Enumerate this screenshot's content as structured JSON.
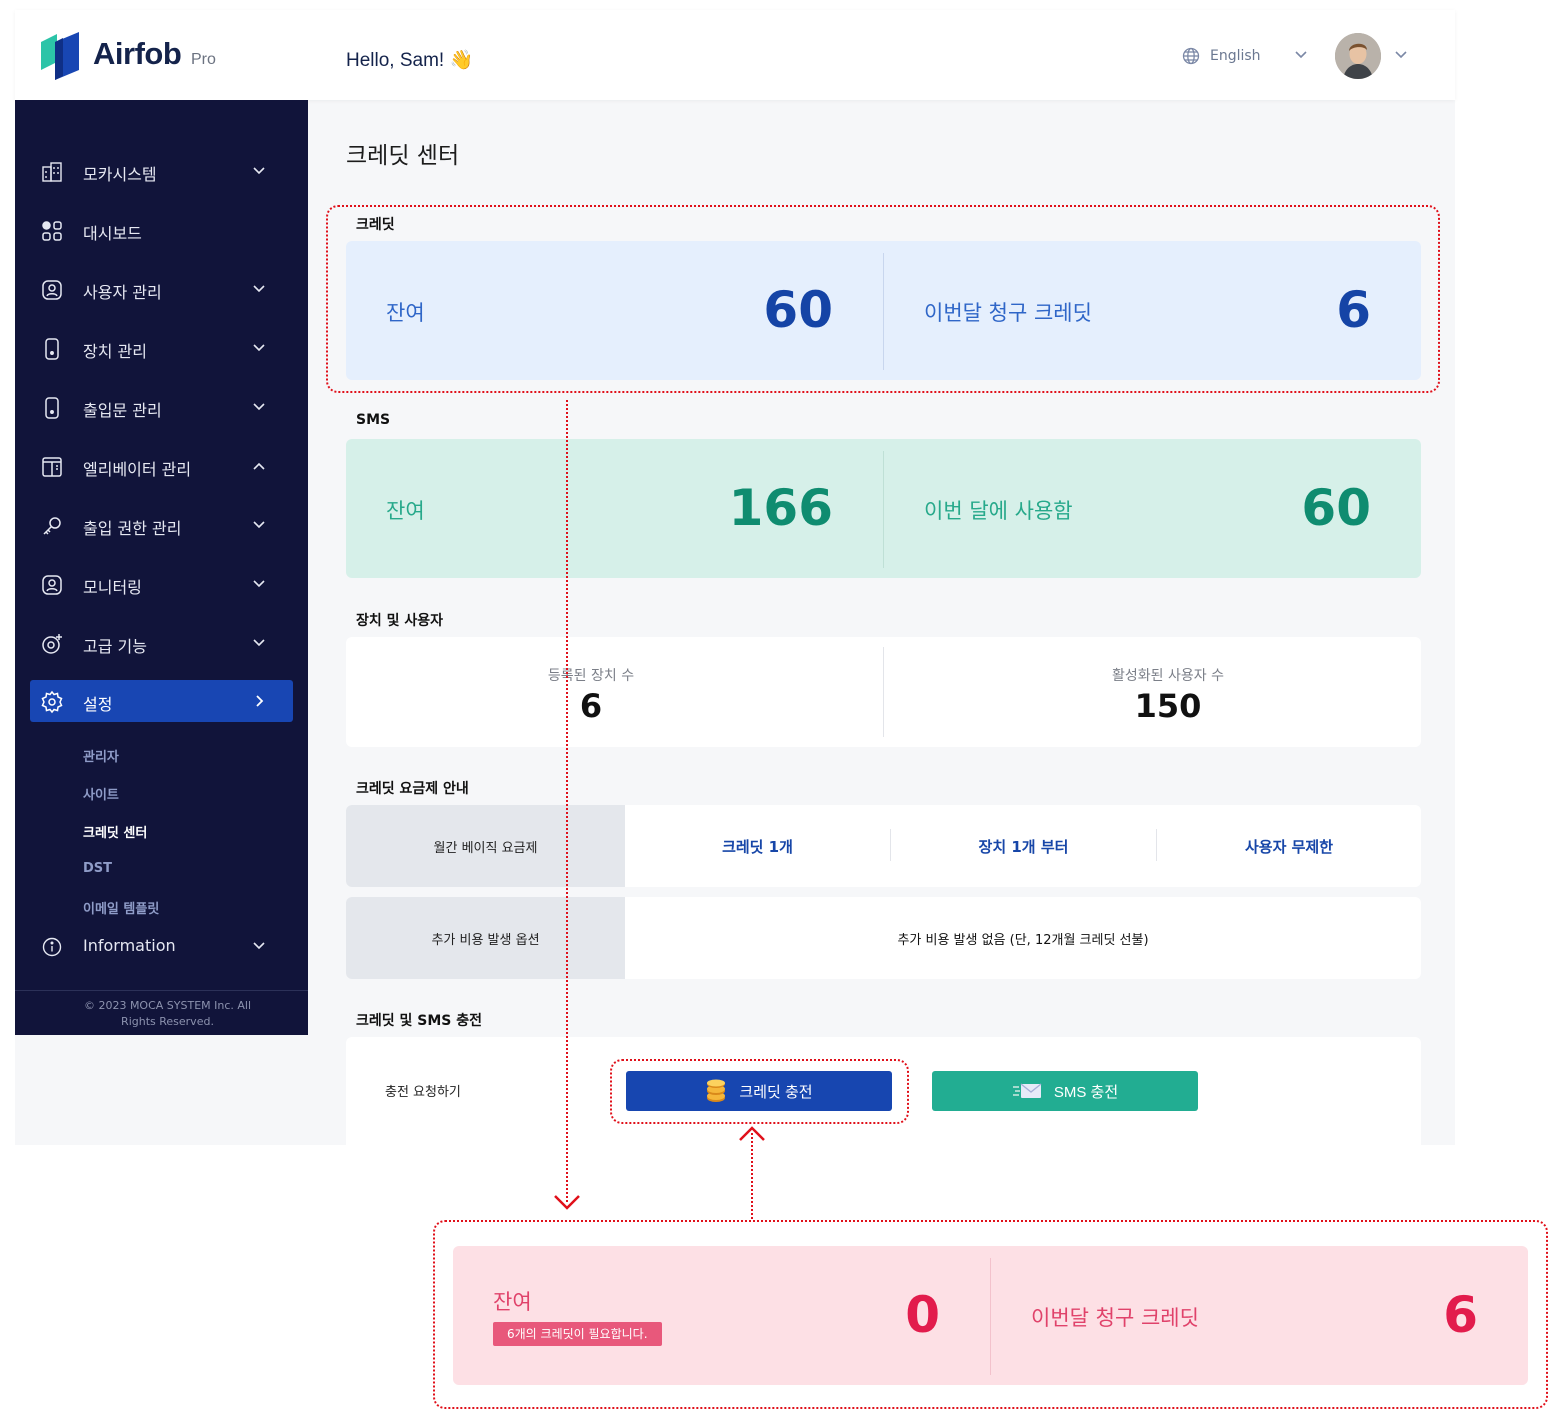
{
  "header": {
    "brand": "Airfob",
    "brand_suffix": "Pro",
    "greeting": "Hello, Sam! 👋",
    "language": "English"
  },
  "sidebar": {
    "items": [
      {
        "label": "모카시스템",
        "icon": "building-icon",
        "chevron": "down"
      },
      {
        "label": "대시보드",
        "icon": "dashboard-grid-icon",
        "chevron": "none"
      },
      {
        "label": "사용자 관리",
        "icon": "user-icon",
        "chevron": "down"
      },
      {
        "label": "장치 관리",
        "icon": "device-icon",
        "chevron": "down"
      },
      {
        "label": "출입문 관리",
        "icon": "door-icon",
        "chevron": "down"
      },
      {
        "label": "엘리베이터 관리",
        "icon": "elevator-icon",
        "chevron": "up"
      },
      {
        "label": "출입 권한 관리",
        "icon": "key-icon",
        "chevron": "down"
      },
      {
        "label": "모니터링",
        "icon": "monitor-user-icon",
        "chevron": "down"
      },
      {
        "label": "고급 기능",
        "icon": "advanced-icon",
        "chevron": "down"
      },
      {
        "label": "설정",
        "icon": "gear-icon",
        "chevron": "right",
        "active": true
      }
    ],
    "subitems": [
      {
        "label": "관리자"
      },
      {
        "label": "사이트"
      },
      {
        "label": "크레딧 센터",
        "current": true
      },
      {
        "label": "DST"
      },
      {
        "label": "이메일 템플릿"
      }
    ],
    "info": {
      "label": "Information",
      "icon": "info-icon"
    },
    "copyright": "© 2023 MOCA SYSTEM Inc. All Rights Reserved."
  },
  "main": {
    "title": "크레딧 센터",
    "credit": {
      "section": "크레딧",
      "balance_label": "잔여",
      "balance_value": "60",
      "billed_label": "이번달 청구 크레딧",
      "billed_value": "6"
    },
    "sms": {
      "section": "SMS",
      "balance_label": "잔여",
      "balance_value": "166",
      "used_label": "이번 달에 사용함",
      "used_value": "60"
    },
    "devices_users": {
      "section": "장치 및 사용자",
      "devices_label": "등록된 장치 수",
      "devices_value": "6",
      "users_label": "활성화된 사용자 수",
      "users_value": "150"
    },
    "plan": {
      "section": "크레딧 요금제 안내",
      "basic_label": "월간 베이직 요금제",
      "basic_cells": [
        "크레딧 1개",
        "장치 1개 부터",
        "사용자 무제한"
      ],
      "extra_label": "추가 비용 발생 옵션",
      "extra_value": "추가 비용 발생 없음 (단, 12개월 크레딧 선불)"
    },
    "charge": {
      "section": "크레딧 및 SMS 충전",
      "request_label": "충전 요청하기",
      "credit_button": "크레딧 충전",
      "sms_button": "SMS 충전"
    }
  },
  "alert_state": {
    "balance_label": "잔여",
    "balance_value": "0",
    "badge": "6개의 크레딧이 필요합니다.",
    "billed_label": "이번달 청구 크레딧",
    "billed_value": "6"
  },
  "colors": {
    "sidebar_bg": "#11143a",
    "accent_blue": "#1746b0",
    "accent_green": "#22ad92",
    "annotation_red": "#e0101a",
    "alert_pink": "#fde0e5"
  }
}
